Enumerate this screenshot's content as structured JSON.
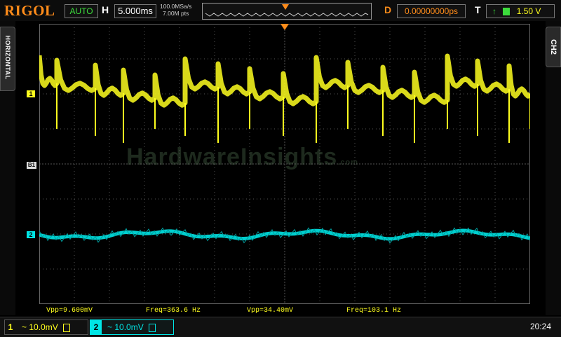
{
  "brand": "RIGOL",
  "topbar": {
    "run_mode": "AUTO",
    "h_label": "H",
    "timebase": "5.000ms",
    "sample_rate": "100.0MSa/s",
    "memory_depth": "7.00M pts",
    "d_label": "D",
    "delay": "0.00000000ps",
    "t_label": "T",
    "trigger_level": "1.50 V"
  },
  "side": {
    "left_tab": "HORIZONTAL",
    "right_tab": "CH2"
  },
  "markers": {
    "ch1": "1",
    "ref": "B1",
    "ch2": "2"
  },
  "measurements": {
    "ch1_vpp": "Vpp=9.600mV",
    "ch1_freq": "Freq=363.6 Hz",
    "ch2_vpp": "Vpp=34.40mV",
    "ch2_freq": "Freq=103.1 Hz"
  },
  "channels": {
    "ch1": {
      "num": "1",
      "scale": "~ 10.0mV"
    },
    "ch2": {
      "num": "2",
      "scale": "~ 10.0mV"
    }
  },
  "clock": "20:24",
  "watermark": {
    "main": "HardwareInsights",
    "suffix": ".com"
  },
  "colors": {
    "ch1": "#ffff1e",
    "ch2": "#00e5e5",
    "brand": "#ff8c1a",
    "grid": "#555555"
  }
}
